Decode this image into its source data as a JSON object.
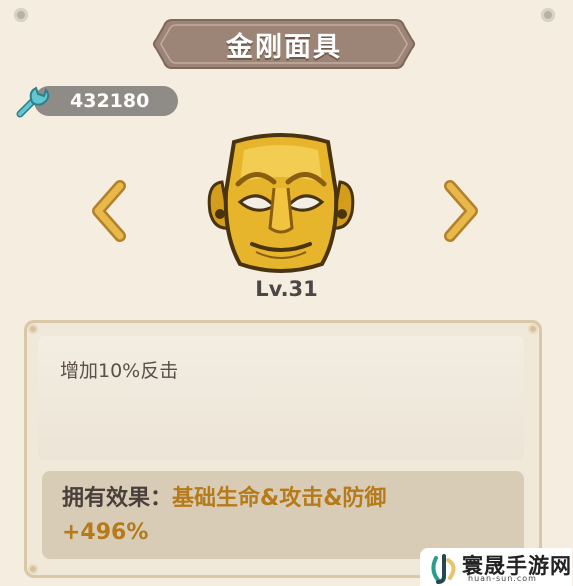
{
  "title": "金刚面具",
  "currency": {
    "icon": "wrench-icon",
    "value": "432180"
  },
  "navigation": {
    "prev_icon": "chevron-left-icon",
    "next_icon": "chevron-right-icon"
  },
  "item": {
    "icon": "golden-mask-icon",
    "level": "Lv.31"
  },
  "description": "增加10%反击",
  "effect": {
    "label": "拥有效果：",
    "value": "基础生命&攻击&防御+496%"
  },
  "watermark": {
    "title": "寰晟手游网",
    "url": "huan-sun.com"
  },
  "colors": {
    "title_banner": "#9c8576",
    "effect_value": "#b57a19",
    "arrow": "#d9a838"
  }
}
